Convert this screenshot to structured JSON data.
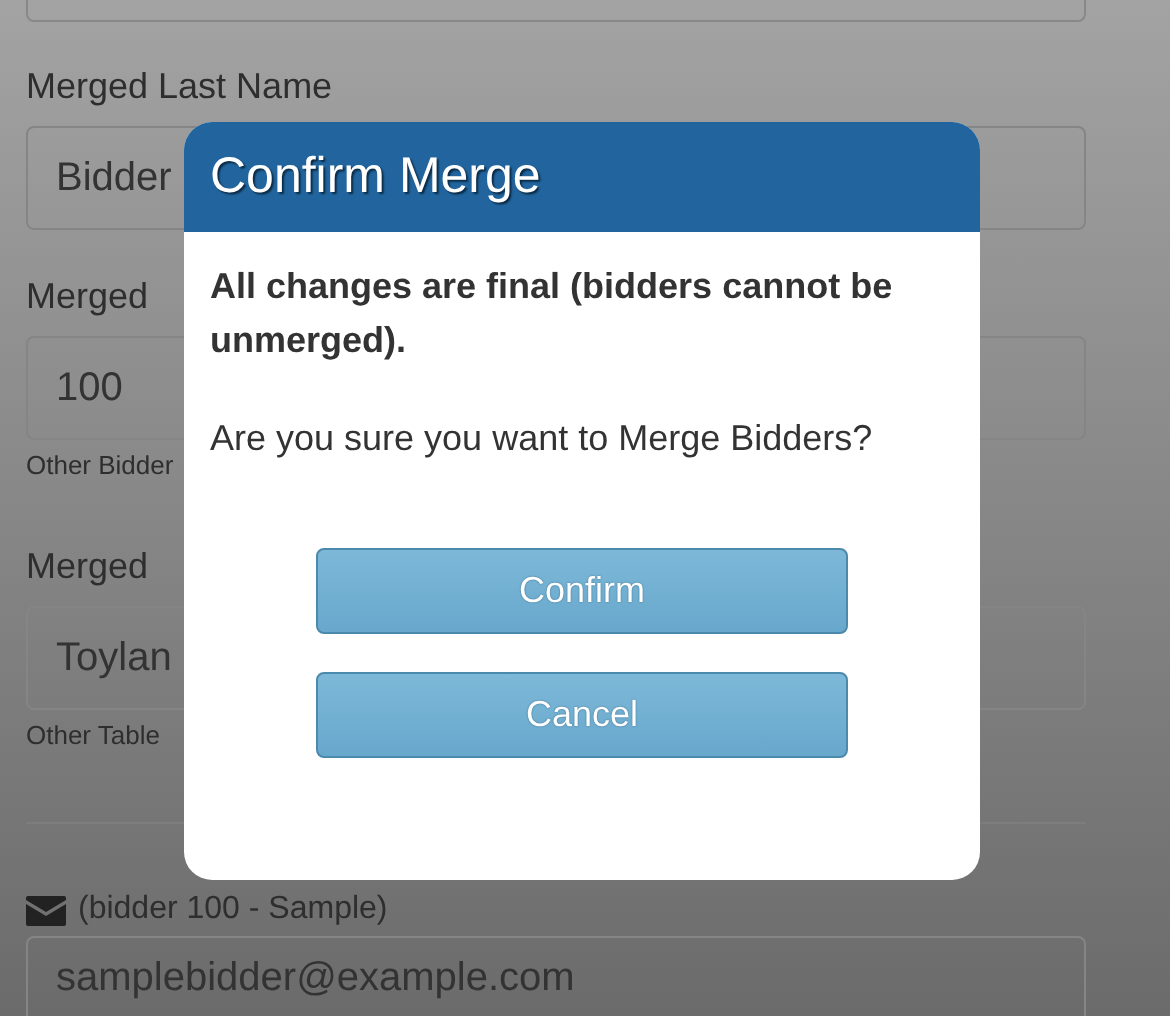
{
  "form": {
    "fields": [
      {
        "label": "Merged Last Name",
        "value": "Bidder"
      },
      {
        "label": "Merged",
        "value": "100",
        "hint": "Other Bidder"
      },
      {
        "label": "Merged",
        "value": "Toylan",
        "hint": "Other Table"
      }
    ],
    "email": {
      "label": "(bidder 100 - Sample)",
      "value": "samplebidder@example.com"
    }
  },
  "dialog": {
    "title": "Confirm Merge",
    "warning": "All changes are final (bidders cannot be unmerged).",
    "question": "Are you sure you want to Merge Bidders?",
    "buttons": [
      "Confirm",
      "Cancel"
    ]
  }
}
